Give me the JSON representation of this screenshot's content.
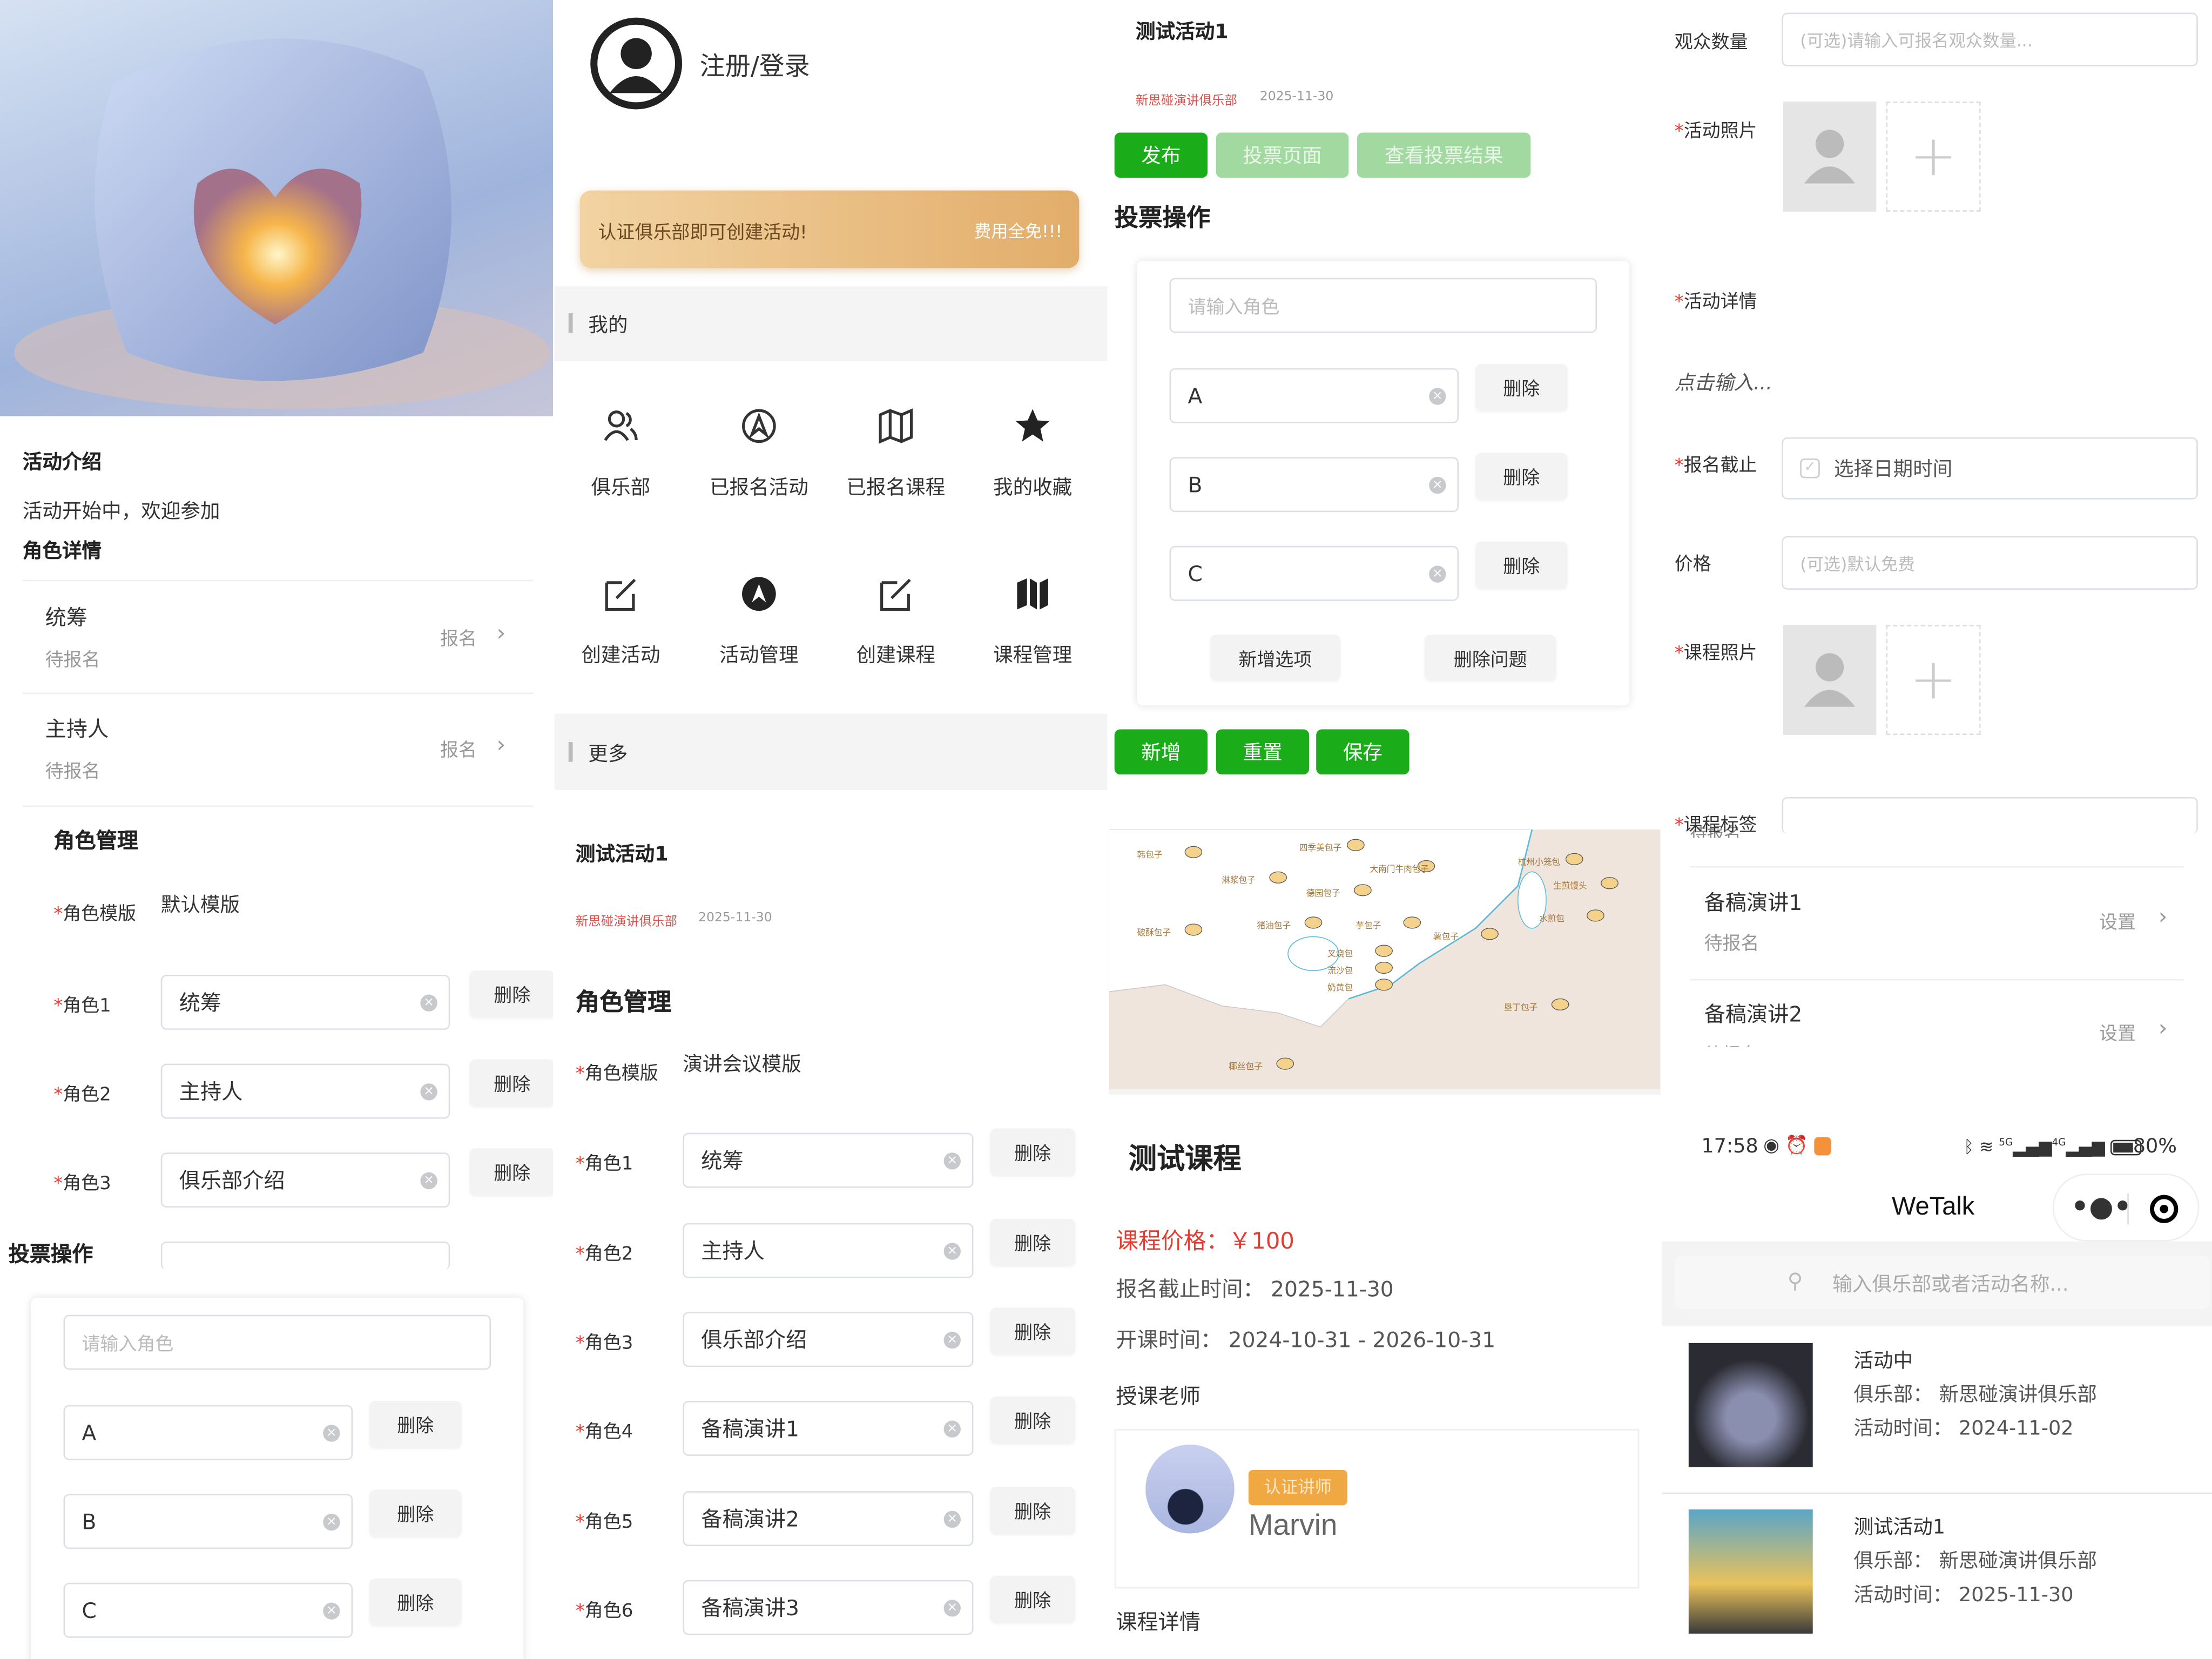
{
  "activity_detail": {
    "intro_title": "活动介绍",
    "intro_text": "活动开始中，欢迎参加",
    "roles_title": "角色详情",
    "roles": [
      {
        "name": "统筹",
        "status": "待报名",
        "action": "报名"
      },
      {
        "name": "主持人",
        "status": "待报名",
        "action": "报名"
      }
    ],
    "role_mgmt_title": "角色管理",
    "template_label": "角色模版",
    "template_value": "默认模版",
    "role_fields": [
      {
        "label": "角色1",
        "value": "统筹"
      },
      {
        "label": "角色2",
        "value": "主持人"
      },
      {
        "label": "角色3",
        "value": "俱乐部介绍"
      }
    ],
    "delete_label": "删除",
    "vote_title": "投票操作",
    "vote_placeholder": "请输入角色",
    "options": [
      "A",
      "B",
      "C"
    ]
  },
  "profile": {
    "login_label": "注册/登录",
    "banner_left": "认证俱乐部即可创建活动!",
    "banner_right": "费用全免!!!",
    "section_mine": "我的",
    "grid": [
      {
        "label": "俱乐部",
        "icon": "users-icon"
      },
      {
        "label": "已报名活动",
        "icon": "compass-icon"
      },
      {
        "label": "已报名课程",
        "icon": "map-icon"
      },
      {
        "label": "我的收藏",
        "icon": "star-icon"
      },
      {
        "label": "创建活动",
        "icon": "edit-icon"
      },
      {
        "label": "活动管理",
        "icon": "compass-filled-icon"
      },
      {
        "label": "创建课程",
        "icon": "edit-icon"
      },
      {
        "label": "课程管理",
        "icon": "map-filled-icon"
      }
    ],
    "section_more": "更多"
  },
  "activity_edit": {
    "title": "测试活动1",
    "club": "新思碰演讲俱乐部",
    "date": "2025-11-30",
    "role_mgmt_title": "角色管理",
    "template_label": "角色模版",
    "template_value": "演讲会议模版",
    "role_fields": [
      {
        "label": "角色1",
        "value": "统筹"
      },
      {
        "label": "角色2",
        "value": "主持人"
      },
      {
        "label": "角色3",
        "value": "俱乐部介绍"
      },
      {
        "label": "角色4",
        "value": "备稿演讲1"
      },
      {
        "label": "角色5",
        "value": "备稿演讲2"
      },
      {
        "label": "角色6",
        "value": "备稿演讲3"
      }
    ],
    "delete_label": "删除"
  },
  "vote": {
    "title": "测试活动1",
    "club": "新思碰演讲俱乐部",
    "date": "2025-11-30",
    "publish": "发布",
    "vote_page": "投票页面",
    "vote_result": "查看投票结果",
    "section": "投票操作",
    "placeholder": "请输入角色",
    "options": [
      "A",
      "B",
      "C"
    ],
    "delete_label": "删除",
    "add_option": "新增选项",
    "delete_question": "删除问题",
    "add": "新增",
    "reset": "重置",
    "save": "保存"
  },
  "map": {
    "labels": [
      "韩包子",
      "四季美包子",
      "大南门牛肉包子",
      "杭州小笼包",
      "淋浆包子",
      "德园包子",
      "生煎馒头",
      "破酥包子",
      "猪油包子",
      "芋包子",
      "薯包子",
      "水煎包",
      "叉烧包",
      "流沙包",
      "奶黄包",
      "垦丁包子",
      "椰丝包子"
    ]
  },
  "course": {
    "title": "测试课程",
    "price_label": "课程价格：",
    "price": "￥100",
    "deadline": "报名截止时间：  2025-11-30",
    "period": "开课时间：  2024-10-31 - 2026-10-31",
    "teacher_title": "授课老师",
    "teacher_badge": "认证讲师",
    "teacher_name": "Marvin",
    "detail_title": "课程详情"
  },
  "form": {
    "audience_label": "观众数量",
    "audience_placeholder": "(可选)请输入可报名观众数量...",
    "photo_label": "活动照片",
    "detail_label": "活动详情",
    "detail_placeholder": "点击输入...",
    "deadline_label": "报名截止",
    "deadline_value": "选择日期时间",
    "price_label": "价格",
    "price_placeholder": "(可选)默认免费",
    "course_photo_label": "课程照片",
    "tag_label": "课程标签",
    "tag_overlap": "待报名",
    "roles": [
      {
        "name": "备稿演讲1",
        "status": "待报名",
        "action": "设置"
      },
      {
        "name": "备稿演讲2",
        "status": "待报名",
        "action": "设置"
      }
    ]
  },
  "home": {
    "time": "17:58",
    "battery": "80%",
    "net5g": "5G",
    "net4g": "4G",
    "app_title": "WeTalk",
    "search_placeholder": "输入俱乐部或者活动名称...",
    "items": [
      {
        "title": "活动中",
        "club": "俱乐部：  新思碰演讲俱乐部",
        "time": "活动时间：  2024-11-02"
      },
      {
        "title": "测试活动1",
        "club": "俱乐部：  新思碰演讲俱乐部",
        "time": "活动时间：  2025-11-30"
      }
    ]
  },
  "colors": {
    "green": "#1aad19",
    "green_disabled": "#a1d9a0",
    "red": "#e43d33",
    "gold": "#e9b876",
    "badge": "#f0a843"
  }
}
